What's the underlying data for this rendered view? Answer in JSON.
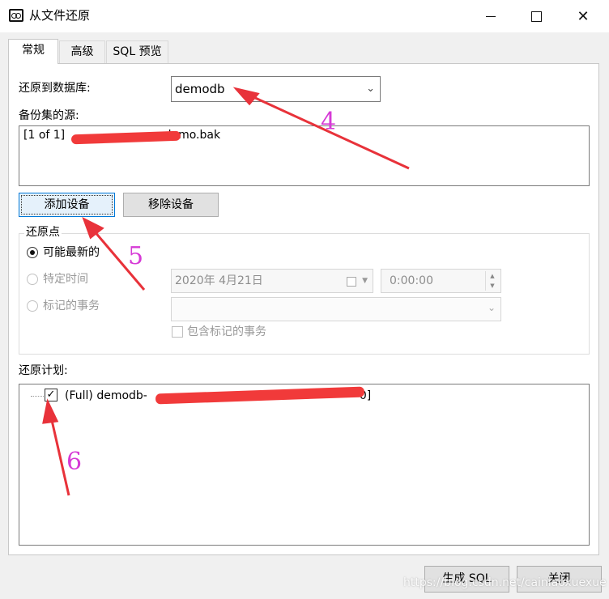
{
  "window": {
    "title": "从文件还原",
    "minimize_symbol": "",
    "close_symbol": "✕"
  },
  "tabs": [
    {
      "label": "常规",
      "active": true
    },
    {
      "label": "高级",
      "active": false
    },
    {
      "label": "SQL 预览",
      "active": false
    }
  ],
  "general": {
    "restore_to_label": "还原到数据库:",
    "database_value": "demodb",
    "backup_source_label": "备份集的源:",
    "backup_source_text": "[1 of 1] ",
    "backup_source_text_tail": "demo.bak",
    "add_device_label": "添加设备",
    "remove_device_label": "移除设备",
    "restore_point": {
      "group_label": "还原点",
      "option_latest": "可能最新的",
      "option_specific_time": "特定时间",
      "option_marked_tx": "标记的事务",
      "date_value": "2020年  4月21日",
      "time_value": "0:00:00",
      "include_marked_label": "包含标记的事务"
    },
    "restore_plan_label": "还原计划:",
    "plan_item_text": "(Full) demodb-",
    "plan_item_tail": "0]"
  },
  "footer": {
    "generate_sql_label": "生成 SQL",
    "close_label": "关闭"
  },
  "annotations": [
    "4",
    "5",
    "6"
  ],
  "annotation_color": "#d63ad6",
  "arrow_color": "#e8323a",
  "watermark": "https://blog.csdn.net/cainiaoxuexue"
}
